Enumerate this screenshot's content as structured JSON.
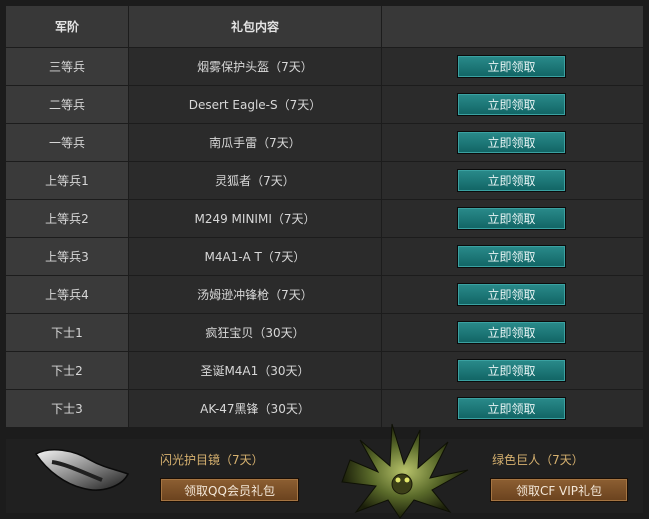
{
  "table": {
    "headers": [
      "军阶",
      "礼包内容",
      ""
    ],
    "rows": [
      {
        "rank": "三等兵",
        "gift": "烟雾保护头盔（7天）",
        "button": "立即领取"
      },
      {
        "rank": "二等兵",
        "gift": "Desert Eagle-S（7天）",
        "button": "立即领取"
      },
      {
        "rank": "一等兵",
        "gift": "南瓜手雷（7天）",
        "button": "立即领取"
      },
      {
        "rank": "上等兵1",
        "gift": "灵狐者（7天）",
        "button": "立即领取"
      },
      {
        "rank": "上等兵2",
        "gift": "M249 MINIMI（7天）",
        "button": "立即领取"
      },
      {
        "rank": "上等兵3",
        "gift": "M4A1-A T（7天）",
        "button": "立即领取"
      },
      {
        "rank": "上等兵4",
        "gift": "汤姆逊冲锋枪（7天）",
        "button": "立即领取"
      },
      {
        "rank": "下士1",
        "gift": "疯狂宝贝（30天）",
        "button": "立即领取"
      },
      {
        "rank": "下士2",
        "gift": "圣诞M4A1（30天）",
        "button": "立即领取"
      },
      {
        "rank": "下士3",
        "gift": "AK-47黑锋（30天）",
        "button": "立即领取"
      }
    ]
  },
  "bottom": {
    "left": {
      "name": "闪光护目镜（7天）",
      "button": "领取QQ会员礼包"
    },
    "right": {
      "name": "绿色巨人（7天）",
      "button": "领取CF VIP礼包"
    }
  },
  "colors": {
    "claim_button": "#1e7a7a",
    "vip_button": "#7c5129",
    "gift_title": "#d6b16f"
  }
}
